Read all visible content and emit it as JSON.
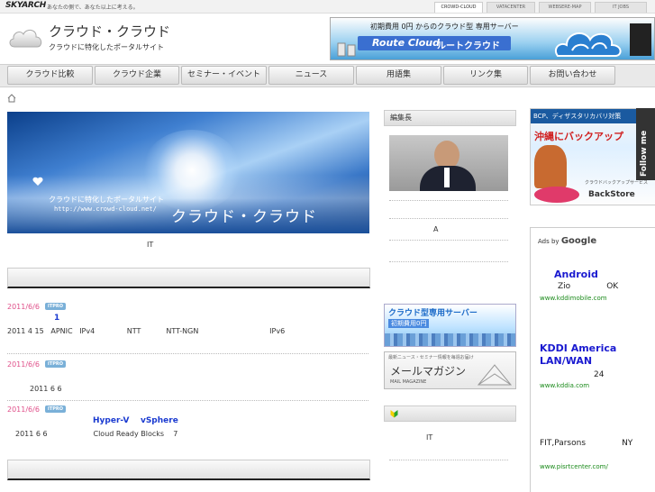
{
  "topbar": {
    "brand": "SKYARCH",
    "tagline": "あなたの側で、あなた以上に考える。",
    "tabs": [
      "CROWD-CLOUD",
      "VATACENTER",
      "WEBSERE-MAP",
      "IT JOBS"
    ]
  },
  "header": {
    "title": "クラウド・クラウド",
    "subtitle": "クラウドに特化したポータルサイト",
    "banner": {
      "line1": "初期費用 0円 からのクラウド型 専用サーバー",
      "brand": "Route Cloud",
      "brand_jp": "ルートクラウド"
    }
  },
  "nav": {
    "items": [
      "クラウド比較",
      "クラウド企業",
      "セミナー・イベント",
      "ニュース",
      "用語集",
      "リンク集",
      "お問い合わせ"
    ]
  },
  "hero": {
    "caption": "クラウドに特化したポータルサイト",
    "url": "http://www.crowd-cloud.net/",
    "title": "クラウド・クラウド"
  },
  "intro_text": "IT",
  "news": [
    {
      "date": "2011/6/6",
      "badge": "ITPRO",
      "title": "1",
      "body": "2011 4 15   APNIC   IPv4              NTT           NTT-NGN                               IPv6"
    },
    {
      "date": "2011/6/6",
      "badge": "ITPRO",
      "title": "",
      "body": "2011 6 6"
    },
    {
      "date": "2011/6/6",
      "badge": "ITPRO",
      "title": "Hyper-V    vSphere",
      "body": "2011 6 6                    Cloud Ready Blocks    7"
    }
  ],
  "editor": {
    "heading": "編集長",
    "text": "A"
  },
  "mid_banners": {
    "server_title": "クラウド型専用サーバー",
    "server_sub": "初期費用0円",
    "mail_small": "最新ニュース・セミナー情報を毎週お届け",
    "mail_title": "メールマガジン",
    "mail_en": "MAIL MAGAZINE"
  },
  "beginner": {
    "text": "IT"
  },
  "right_ad": {
    "line1": "BCP、ディザスタリカバリ対策",
    "line2": "沖縄にバックアップ",
    "line3": "クラウドバックアップサービス",
    "brand": "BackStore",
    "follow": "Follow me"
  },
  "google_ads": {
    "label_prefix": "Ads by",
    "label_brand": "Google",
    "ads": [
      {
        "title": "Android",
        "text": "Zio              OK",
        "url": "www.kddimobile.com"
      },
      {
        "title": "KDDI America LAN/WAN",
        "text": "24",
        "url": "www.kddia.com"
      },
      {
        "title": "",
        "text": "FIT,Parsons              NY",
        "url": "www.pisrtcenter.com/"
      }
    ]
  }
}
